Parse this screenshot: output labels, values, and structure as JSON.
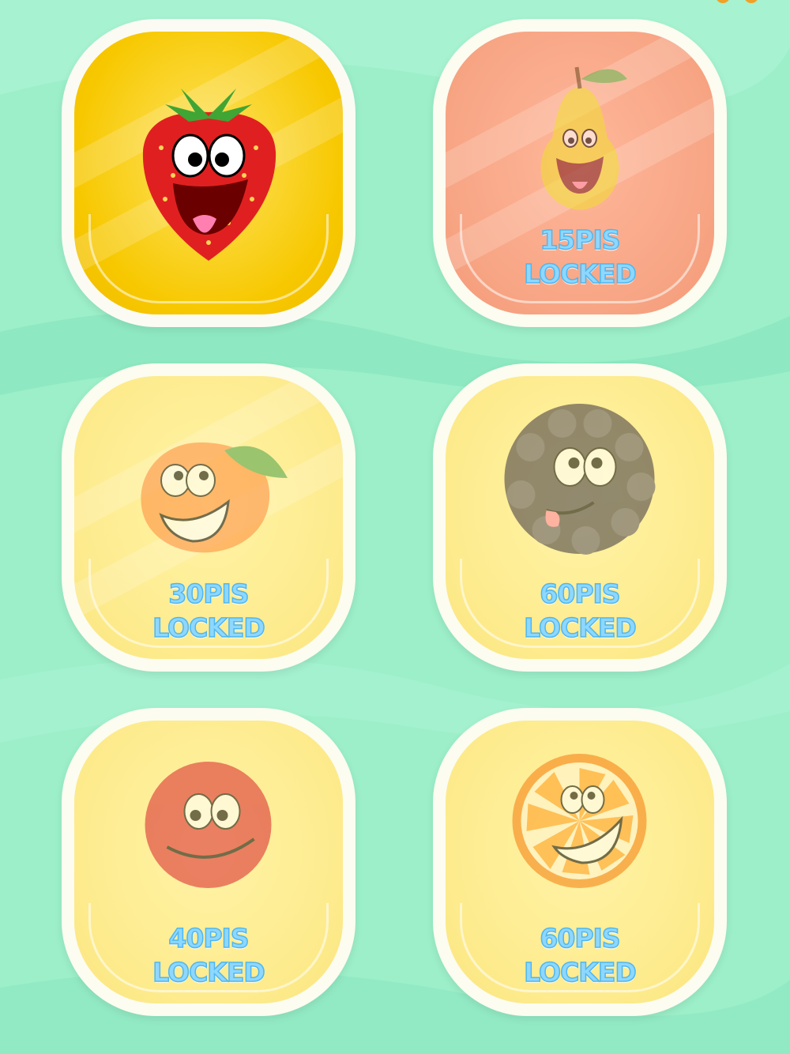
{
  "levels": [
    {
      "fruit": "strawberry",
      "icon": "strawberry-icon",
      "price": "",
      "status": "",
      "locked": false,
      "tile_color": "#f7c800"
    },
    {
      "fruit": "pear",
      "icon": "pear-icon",
      "price": "15PIS",
      "status": "LOCKED",
      "locked": true,
      "tile_color": "#f7a584"
    },
    {
      "fruit": "peach",
      "icon": "peach-icon",
      "price": "30PIS",
      "status": "LOCKED",
      "locked": true,
      "tile_color": "#fdeb8d"
    },
    {
      "fruit": "blackberry",
      "icon": "blackberry-icon",
      "price": "60PIS",
      "status": "LOCKED",
      "locked": true,
      "tile_color": "#fdeb8d"
    },
    {
      "fruit": "cherry",
      "icon": "cherry-icon",
      "price": "40PIS",
      "status": "LOCKED",
      "locked": true,
      "tile_color": "#fdeb8d"
    },
    {
      "fruit": "orange",
      "icon": "orange-slice-icon",
      "price": "60PIS",
      "status": "LOCKED",
      "locked": true,
      "tile_color": "#fdeb8d"
    }
  ],
  "colors": {
    "background": "#9cefc9",
    "label_fill": "#8ed7ff",
    "label_stroke": "#4fb7f0"
  }
}
